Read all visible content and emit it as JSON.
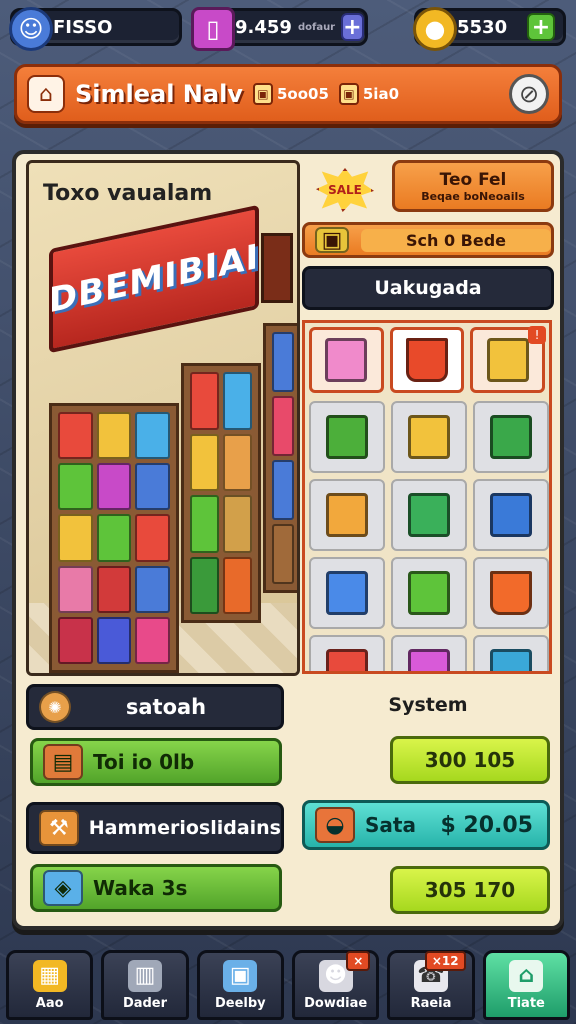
{
  "hud": {
    "gems": {
      "icon": "mascot-icon",
      "value": "FISSO"
    },
    "energy": {
      "icon": "phone-icon",
      "value": "9.459",
      "suffix": "dofaur"
    },
    "coins": {
      "icon": "coin-stack-icon",
      "value": "5530"
    }
  },
  "header": {
    "title": "Simleal Nalv",
    "stat1": "5oo05",
    "stat2": "5ia0"
  },
  "scene": {
    "title": "Toxo vaualam",
    "banner": "DBEMIBIAI"
  },
  "side": {
    "sale_badge": "SALE",
    "top_button": {
      "line1": "Teo Fel",
      "line2": "Beqae boNeoails"
    },
    "sub_button": "Sch 0 Bede",
    "section_label": "Uakugada"
  },
  "left_actions": {
    "banner": "satoah",
    "item1": "Toi io 0lb",
    "item2": "Hammerioslidains",
    "item3": "Waka 3s"
  },
  "right_actions": {
    "label": "System",
    "price1": "300 105",
    "sale_label": "Sata",
    "sale_price": "$ 20.05",
    "price2": "305 170"
  },
  "nav": [
    {
      "label": "Aao",
      "icon": "crate-icon"
    },
    {
      "label": "Dader",
      "icon": "bin-icon"
    },
    {
      "label": "Deelby",
      "icon": "bag-icon"
    },
    {
      "label": "Dowdiae",
      "icon": "skull-icon",
      "badge": "×"
    },
    {
      "label": "Raeia",
      "icon": "phone-icon",
      "badge": "×12"
    },
    {
      "label": "Tiate",
      "icon": "store-icon"
    }
  ]
}
